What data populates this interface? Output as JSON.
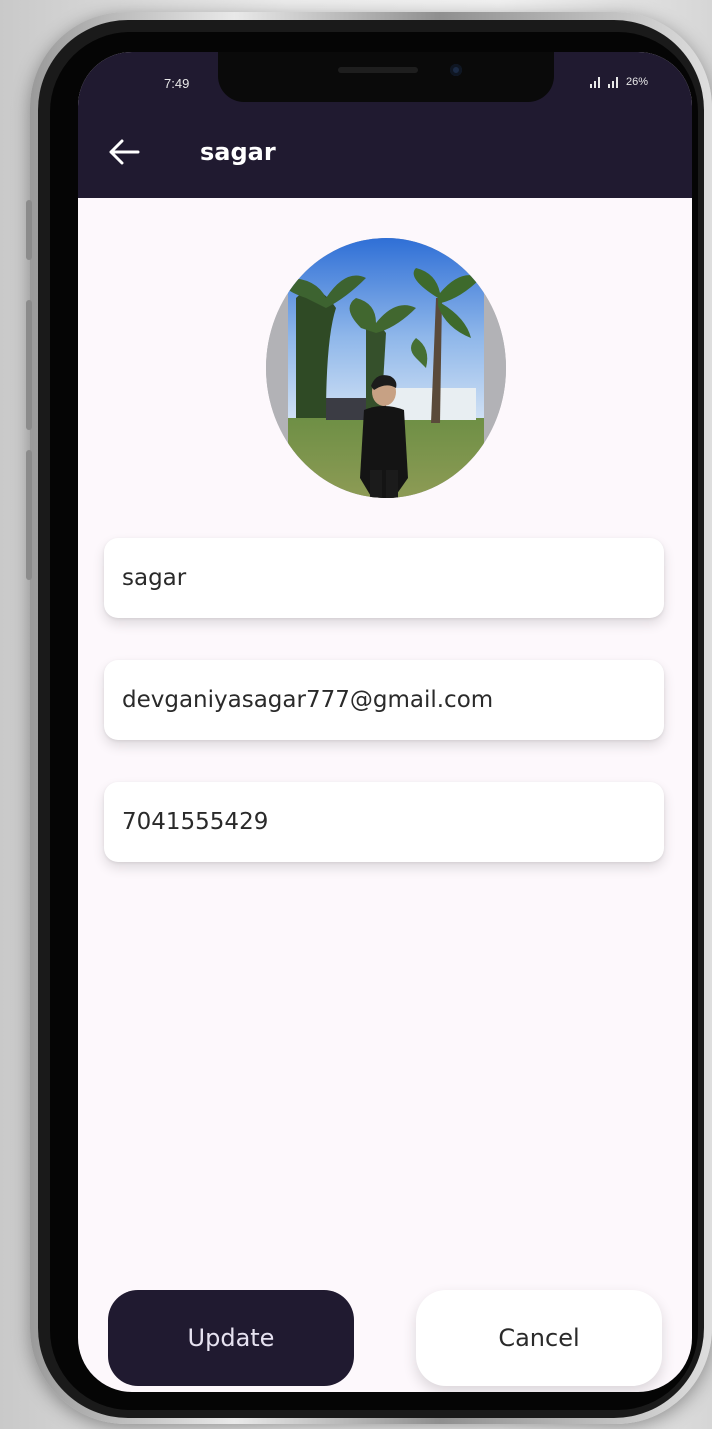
{
  "status_bar": {
    "time": "7:49",
    "battery": "26%"
  },
  "app_bar": {
    "back_icon": "arrow-left-icon",
    "title": "sagar"
  },
  "profile": {
    "avatar": "profile-photo"
  },
  "form": {
    "name_value": "sagar",
    "email_value": "devganiyasagar777@gmail.com",
    "phone_value": "7041555429"
  },
  "actions": {
    "update_label": "Update",
    "cancel_label": "Cancel"
  },
  "colors": {
    "app_bar": "#201a30",
    "background": "#fdf8fc",
    "update_button": "#201a30",
    "cancel_button": "#ffffff"
  }
}
